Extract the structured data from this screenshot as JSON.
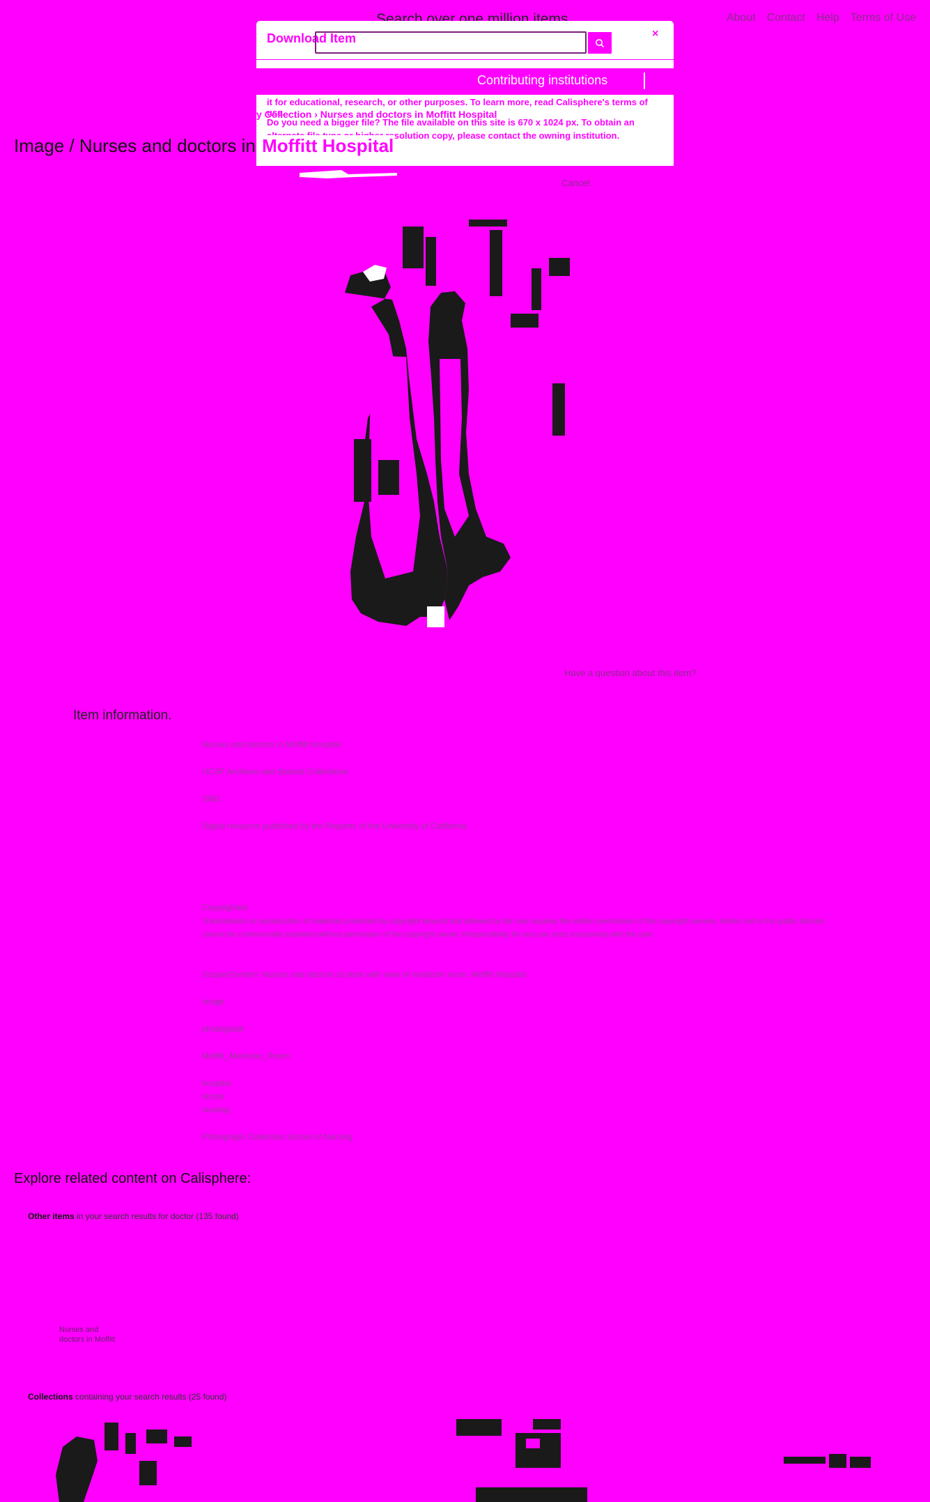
{
  "header": {
    "search_title": "Search over one million items",
    "nav": [
      "About",
      "Contact",
      "Help",
      "Terms of Use"
    ]
  },
  "modal": {
    "title": "Download Item",
    "close": "×",
    "contributing": "Contributing institutions",
    "line1": "it for educational, research, or other purposes. To learn more, read Calisphere's terms of use.",
    "line2": "Do you need a bigger file? The file available on this site is 670 x 1024 px. To obtain an alternate file type or higher resolution copy, please contact the owning institution."
  },
  "breadcrumb": "y Collection  ›  Nurses and doctors in Moffitt Hospital",
  "page_title": {
    "prefix": "Image / Nurses and doctors in ",
    "highlight": "Moffitt Hospital"
  },
  "cancel": "Cancel",
  "question_link": "Have a question about this item?",
  "item_info_heading": "Item information.",
  "metadata": [
    "Nurses and doctors in Moffitt Hospital",
    "UCSF Archives and Special Collections",
    "1961",
    "Digital resource published by the Regents of the University of California"
  ],
  "rights": {
    "status": "Copyrighted",
    "statement": "Transmission or reproduction of materials protected by copyright beyond that allowed by fair use requires the written permission of the copyright owners. Works not in the public domain cannot be commercially exploited without permission of the copyright owner. Responsibility for any use rests exclusively with the user."
  },
  "scope": "Scope/Content: Nurses and doctors at desk with view of medicine room. Moffitt Hospital",
  "type": "image",
  "format": "photograph",
  "subject": "Moffitt_Medicine_Room",
  "keywords": [
    "hospital",
    "doctor",
    "nursing"
  ],
  "collection": "Photograph Collection School of Nursing",
  "related": {
    "heading": "Explore related content on Calisphere:",
    "other_items_label": "Other items",
    "other_items_text": " in your search results for doctor (135 found)",
    "thumb_caption_1": "Nurses and",
    "thumb_caption_2": "doctors in Moffitt",
    "collections_label": "Collections",
    "collections_text": " containing your search results (25 found)"
  },
  "colors": {
    "background": "#ff00ff",
    "panel": "#ffffff",
    "photo_ink": "#1a1a1a"
  }
}
